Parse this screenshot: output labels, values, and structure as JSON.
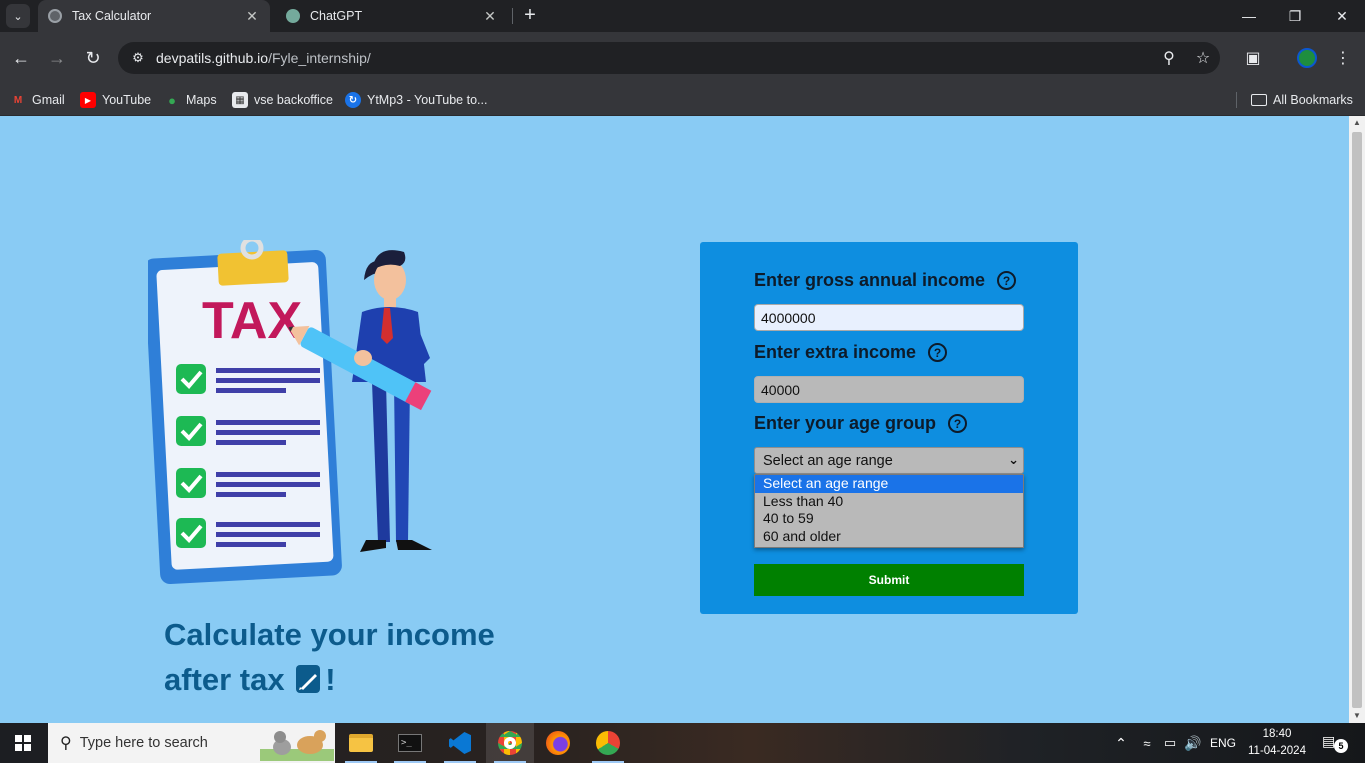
{
  "browser": {
    "tabs": [
      {
        "title": "Tax Calculator",
        "active": true
      },
      {
        "title": "ChatGPT",
        "active": false
      }
    ],
    "url_domain": "devpatils.github.io",
    "url_path": "/Fyle_internship/",
    "bookmarks": [
      "Gmail",
      "YouTube",
      "Maps",
      "vse backoffice",
      "YtMp3 - YouTube to..."
    ],
    "all_bookmarks_label": "All Bookmarks"
  },
  "page": {
    "headline_line1": "Calculate your income",
    "headline_line2": "after tax",
    "headline_suffix": "!",
    "illustration_text": "TAX",
    "colors": {
      "background": "#89cbf4",
      "card": "#0e8ee0",
      "headline": "#0c5b8c",
      "submit": "#008000"
    }
  },
  "form": {
    "income_label": "Enter gross annual income",
    "income_value": "4000000",
    "extra_label": "Enter extra income",
    "extra_value": "40000",
    "age_label": "Enter your age group",
    "help_icon_glyph": "?",
    "age_select_value": "Select an age range",
    "age_options": [
      "Select an age range",
      "Less than 40",
      "40 to 59",
      "60 and older"
    ],
    "submit_label": "Submit"
  },
  "taskbar": {
    "search_placeholder": "Type here to search",
    "language": "ENG",
    "time": "18:40",
    "date": "11-04-2024",
    "notification_count": "5"
  }
}
